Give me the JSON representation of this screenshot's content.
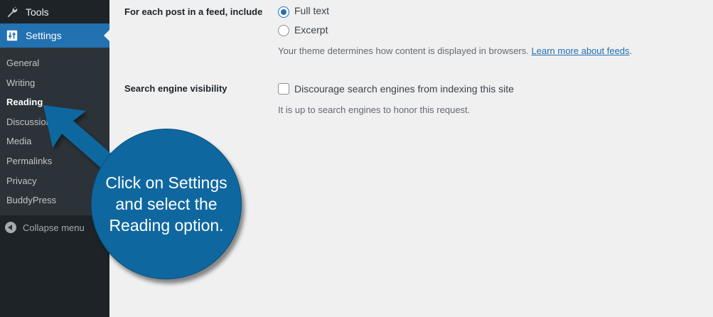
{
  "sidebar": {
    "tools_label": "Tools",
    "settings_label": "Settings",
    "submenu": [
      "General",
      "Writing",
      "Reading",
      "Discussion",
      "Media",
      "Permalinks",
      "Privacy",
      "BuddyPress"
    ],
    "current": "Reading",
    "collapse_label": "Collapse menu"
  },
  "feed": {
    "label": "For each post in a feed, include",
    "options": [
      "Full text",
      "Excerpt"
    ],
    "selected": "Full text",
    "desc_text": "Your theme determines how content is displayed in browsers.",
    "desc_link": "Learn more about feeds",
    "desc_end": "."
  },
  "search": {
    "label": "Search engine visibility",
    "checkbox_label": "Discourage search engines from indexing this site",
    "checked": false,
    "desc": "It is up to search engines to honor this request."
  },
  "callout": {
    "text": "Click on Settings and select the Reading option."
  },
  "colors": {
    "admin_blue": "#2271b1",
    "callout_blue": "#0f67a0",
    "sidebar_dark": "#1d2327"
  }
}
